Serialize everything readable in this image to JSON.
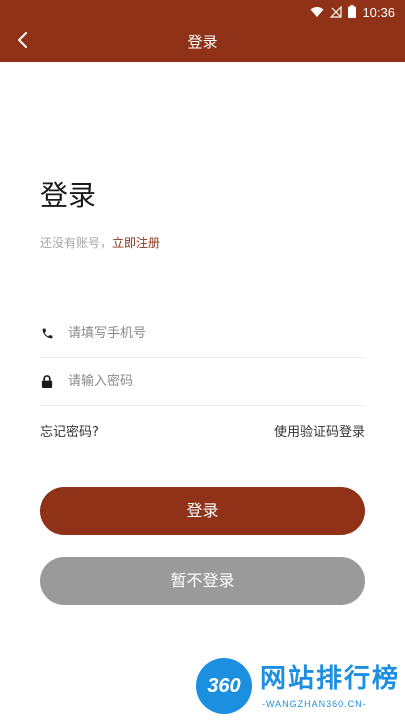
{
  "status_bar": {
    "time": "10:36",
    "icons": [
      "wifi-icon",
      "no-signal-icon",
      "battery-icon"
    ]
  },
  "app_bar": {
    "title": "登录",
    "back_icon": "chevron-left-icon"
  },
  "login": {
    "title": "登录",
    "no_account_text": "还没有账号，",
    "register_link": "立即注册",
    "phone_placeholder": "请填写手机号",
    "password_placeholder": "请输入密码",
    "forgot_password": "忘记密码?",
    "sms_login": "使用验证码登录",
    "login_button": "登录",
    "skip_button": "暂不登录"
  },
  "watermark": {
    "logo_text": "360",
    "title": "网站排行榜",
    "subtitle": "-WANGZHAN360.CN-"
  },
  "colors": {
    "primary": "#8f3217",
    "disabled_button": "#9a9a9a",
    "watermark_blue": "#1d8fe1"
  }
}
